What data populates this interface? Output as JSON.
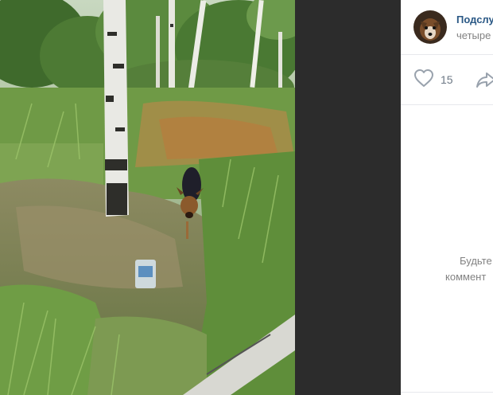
{
  "post": {
    "author_name": "Подслу",
    "date": "четыре"
  },
  "actions": {
    "likes_count": "15",
    "like_icon": "heart-outline-icon",
    "share_icon": "share-arrow-icon"
  },
  "comments": {
    "empty_line_1": "Будьте",
    "empty_line_2": "коммент"
  },
  "colors": {
    "link": "#2a5885",
    "secondary_text": "#828282",
    "divider": "#e7e8ec",
    "viewer_background": "#2c2c2c"
  }
}
